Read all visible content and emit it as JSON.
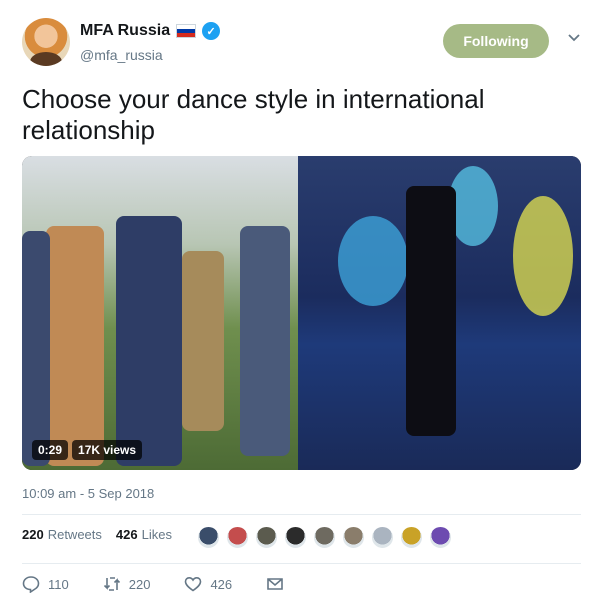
{
  "account": {
    "display_name": "MFA Russia",
    "handle": "@mfa_russia",
    "verified_mark": "✓",
    "flag_colors": [
      "#ffffff",
      "#0039a6",
      "#d52b1e"
    ],
    "follow_label": "Following",
    "follow_color": "#a6ba86"
  },
  "tweet": {
    "text": "Choose your dance style in international relationship",
    "timestamp": "10:09 am - 5 Sep 2018"
  },
  "video": {
    "duration": "0:29",
    "views": "17K views"
  },
  "stats": {
    "retweets_count": "220",
    "retweets_label": "Retweets",
    "likes_count": "426",
    "likes_label": "Likes"
  },
  "likers": [
    "#3a4d6a",
    "#c44d4d",
    "#5b5b4e",
    "#2b2b2b",
    "#6e6a60",
    "#8a7d6b",
    "#aab4c0",
    "#c9a227",
    "#6d4bb0"
  ],
  "actions": {
    "reply_count": "110",
    "retweet_count": "220",
    "like_count": "426"
  },
  "icons": {
    "reply": "reply-icon",
    "retweet": "retweet-icon",
    "like": "heart-icon",
    "dm": "envelope-icon",
    "menu": "chevron-down-icon"
  }
}
